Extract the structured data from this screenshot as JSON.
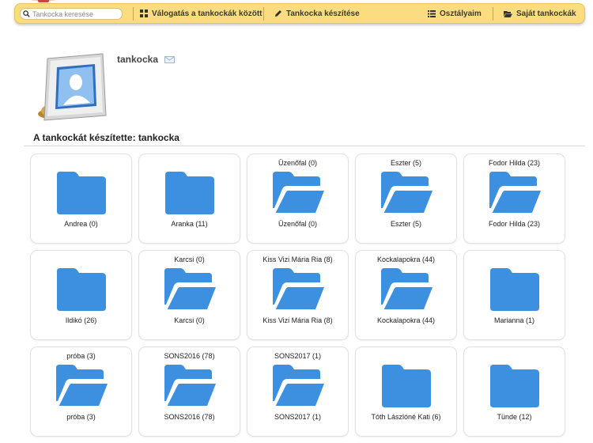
{
  "search": {
    "placeholder": "Tankocka keresése"
  },
  "nav": {
    "browse": {
      "label": "Válogatás a tankockák között",
      "icon": "grid-icon"
    },
    "create": {
      "label": "Tankocka készítése",
      "icon": "pencil-icon"
    },
    "classes": {
      "label": "Osztályaim",
      "icon": "list-icon"
    },
    "own": {
      "label": "Saját tankockák",
      "icon": "folder-open-icon"
    }
  },
  "profile": {
    "username": "tankocka",
    "mail_icon": "envelope-icon"
  },
  "section": {
    "title": "A tankockát készítette: tankocka"
  },
  "colors": {
    "navbar": "#fbdc7f",
    "folder": "#3d8fe0"
  },
  "folders": [
    {
      "top": "",
      "label": "Andrea (0)",
      "icon": "folder-closed-icon"
    },
    {
      "top": "",
      "label": "Aranka (11)",
      "icon": "folder-closed-icon"
    },
    {
      "top": "Üzenőfal (0)",
      "label": "Üzenőfal (0)",
      "icon": "folder-open-icon"
    },
    {
      "top": "Eszter (5)",
      "label": "Eszter (5)",
      "icon": "folder-open-icon"
    },
    {
      "top": "Fodor Hilda (23)",
      "label": "Fodor Hilda (23)",
      "icon": "folder-open-icon"
    },
    {
      "top": "",
      "label": "Ildikó (26)",
      "icon": "folder-closed-icon"
    },
    {
      "top": "Karcsi (0)",
      "label": "Karcsi (0)",
      "icon": "folder-open-icon"
    },
    {
      "top": "Kiss Vizi Mária Ria (8)",
      "label": "Kiss Vizi Mária Ria (8)",
      "icon": "folder-open-icon"
    },
    {
      "top": "Kockalapokra (44)",
      "label": "Kockalapokra (44)",
      "icon": "folder-open-icon"
    },
    {
      "top": "",
      "label": "Marianna (1)",
      "icon": "folder-closed-icon"
    },
    {
      "top": "próba (3)",
      "label": "próba (3)",
      "icon": "folder-open-icon"
    },
    {
      "top": "SONS2016 (78)",
      "label": "SONS2016 (78)",
      "icon": "folder-open-icon"
    },
    {
      "top": "SONS2017 (1)",
      "label": "SONS2017 (1)",
      "icon": "folder-open-icon"
    },
    {
      "top": "",
      "label": "Tóth Lászlóné Kati (6)",
      "icon": "folder-closed-icon"
    },
    {
      "top": "",
      "label": "Tünde (12)",
      "icon": "folder-closed-icon"
    }
  ]
}
